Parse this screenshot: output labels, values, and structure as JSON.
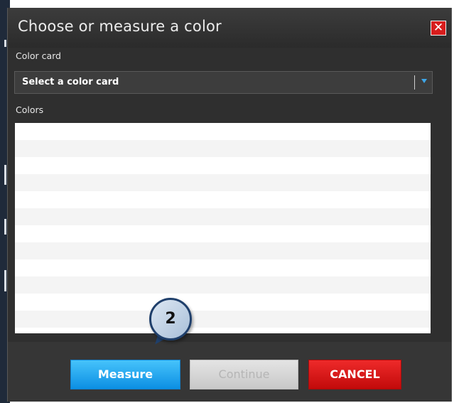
{
  "dialog": {
    "title": "Choose or measure a color",
    "close_label": "✕"
  },
  "color_card": {
    "label": "Color card",
    "selected_value": "Select a color card"
  },
  "colors": {
    "label": "Colors",
    "items": []
  },
  "buttons": {
    "measure_label": "Measure",
    "continue_label": "Continue",
    "cancel_label": "CANCEL"
  },
  "callout": {
    "step_number": "2"
  },
  "theme": {
    "measure_color": "#1aa7ef",
    "cancel_color": "#db1b1b",
    "close_color": "#d81d1d",
    "callout_border": "#1f3f6b"
  }
}
